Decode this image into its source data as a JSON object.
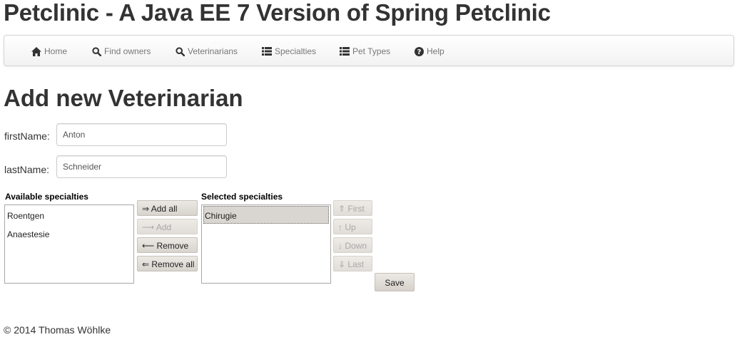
{
  "app_title": "Petclinic - A Java EE 7 Version of Spring Petclinic",
  "nav": {
    "items": [
      {
        "label": "Home",
        "icon": "home-icon"
      },
      {
        "label": "Find owners",
        "icon": "search-icon"
      },
      {
        "label": "Veterinarians",
        "icon": "search-icon"
      },
      {
        "label": "Specialties",
        "icon": "list-icon"
      },
      {
        "label": "Pet Types",
        "icon": "list-icon"
      },
      {
        "label": "Help",
        "icon": "question-circle-icon"
      }
    ]
  },
  "page_heading": "Add new Veterinarian",
  "form": {
    "first_name": {
      "label": "firstName:",
      "value": "Anton"
    },
    "last_name": {
      "label": "lastName:",
      "value": "Schneider"
    }
  },
  "picklist": {
    "available_caption": "Available specialties",
    "available_items": [
      "Roentgen",
      "Anaestesie"
    ],
    "selected_caption": "Selected specialties",
    "selected_items": [
      "Chirugie"
    ],
    "buttons": {
      "add_all": "⇒ Add all",
      "add": "⟶ Add",
      "remove": "⟵ Remove",
      "remove_all": "⇐ Remove all"
    },
    "order_buttons": {
      "first": "⇑ First",
      "up": "↑ Up",
      "down": "↓ Down",
      "last": "⇓ Last"
    }
  },
  "save_label": "Save",
  "footer": "© 2014 Thomas Wöhlke",
  "colors": {
    "navbar_bg": "#f7f7f7",
    "nav_text": "#777777",
    "selected_item_bg": "#d9d5d0"
  }
}
